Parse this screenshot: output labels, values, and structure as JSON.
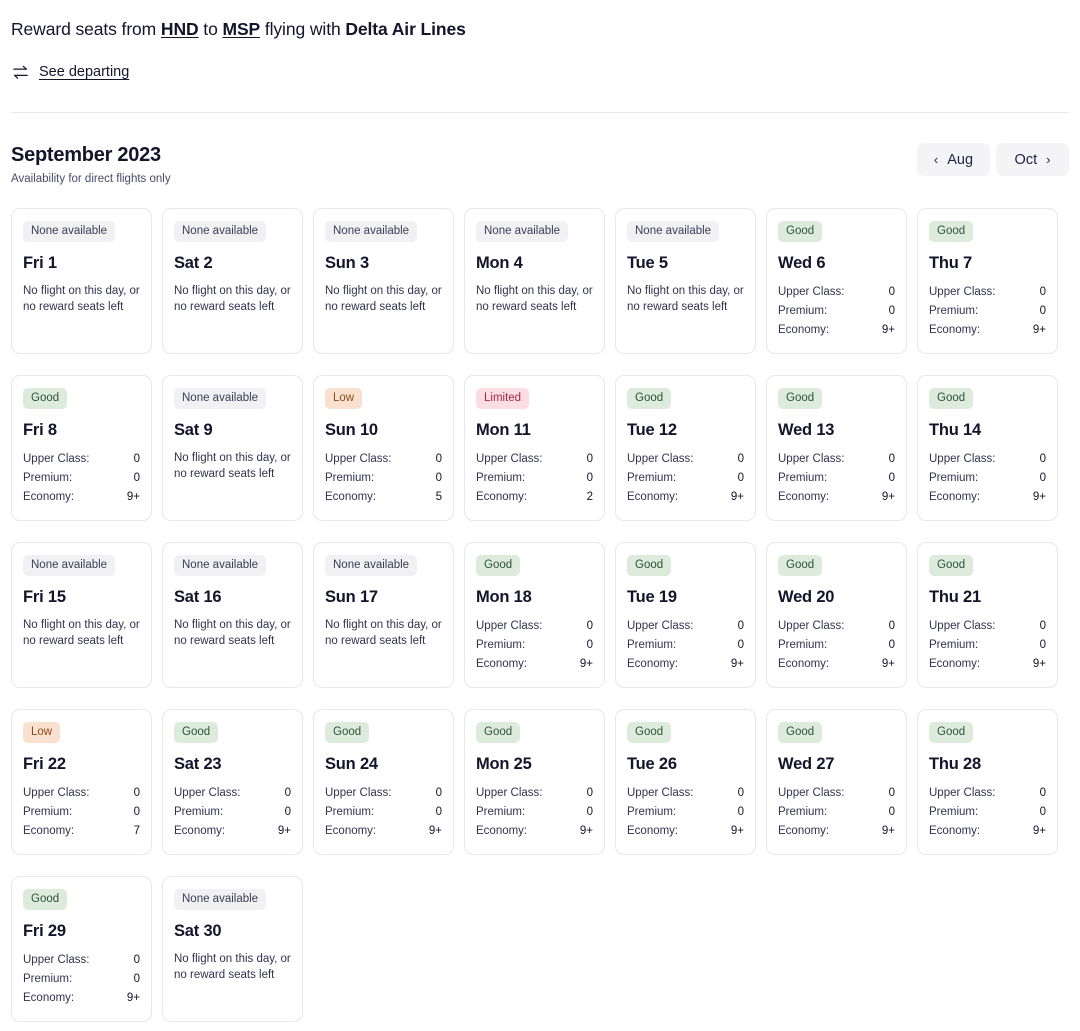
{
  "header": {
    "title_prefix": "Reward seats from ",
    "origin": "HND",
    "title_mid": " to ",
    "destination": "MSP",
    "title_mid2": " flying with ",
    "airline": "Delta Air Lines",
    "swap_icon": "swap-arrows-icon",
    "see_departing_label": "See departing"
  },
  "month": {
    "title": "September 2023",
    "subtitle": "Availability for direct flights only",
    "prev_label": "Aug",
    "prev_chevron": "‹",
    "next_label": "Oct",
    "next_chevron": "›"
  },
  "legend_colors": {
    "good_bg": "#dcebdc",
    "good_text": "#2e5436",
    "low_bg": "#fae0cf",
    "low_text": "#8a4b1c",
    "limited_bg": "#fbdde4",
    "limited_text": "#a6264c",
    "none_bg": "#f1f1f3",
    "none_text": "#3c3c55"
  },
  "seat_labels": {
    "upper": "Upper Class:",
    "premium": "Premium:",
    "economy": "Economy:"
  },
  "no_flight_text": "No flight on this day, or no reward seats left",
  "days": [
    {
      "day": "Fri 1",
      "status": "None available",
      "status_key": "none",
      "available": false
    },
    {
      "day": "Sat 2",
      "status": "None available",
      "status_key": "none",
      "available": false
    },
    {
      "day": "Sun 3",
      "status": "None available",
      "status_key": "none",
      "available": false
    },
    {
      "day": "Mon 4",
      "status": "None available",
      "status_key": "none",
      "available": false
    },
    {
      "day": "Tue 5",
      "status": "None available",
      "status_key": "none",
      "available": false
    },
    {
      "day": "Wed 6",
      "status": "Good",
      "status_key": "good",
      "available": true,
      "upper": "0",
      "premium": "0",
      "economy": "9+"
    },
    {
      "day": "Thu 7",
      "status": "Good",
      "status_key": "good",
      "available": true,
      "upper": "0",
      "premium": "0",
      "economy": "9+"
    },
    {
      "day": "Fri 8",
      "status": "Good",
      "status_key": "good",
      "available": true,
      "upper": "0",
      "premium": "0",
      "economy": "9+"
    },
    {
      "day": "Sat 9",
      "status": "None available",
      "status_key": "none",
      "available": false
    },
    {
      "day": "Sun 10",
      "status": "Low",
      "status_key": "low",
      "available": true,
      "upper": "0",
      "premium": "0",
      "economy": "5"
    },
    {
      "day": "Mon 11",
      "status": "Limited",
      "status_key": "limited",
      "available": true,
      "upper": "0",
      "premium": "0",
      "economy": "2"
    },
    {
      "day": "Tue 12",
      "status": "Good",
      "status_key": "good",
      "available": true,
      "upper": "0",
      "premium": "0",
      "economy": "9+"
    },
    {
      "day": "Wed 13",
      "status": "Good",
      "status_key": "good",
      "available": true,
      "upper": "0",
      "premium": "0",
      "economy": "9+"
    },
    {
      "day": "Thu 14",
      "status": "Good",
      "status_key": "good",
      "available": true,
      "upper": "0",
      "premium": "0",
      "economy": "9+"
    },
    {
      "day": "Fri 15",
      "status": "None available",
      "status_key": "none",
      "available": false
    },
    {
      "day": "Sat 16",
      "status": "None available",
      "status_key": "none",
      "available": false
    },
    {
      "day": "Sun 17",
      "status": "None available",
      "status_key": "none",
      "available": false
    },
    {
      "day": "Mon 18",
      "status": "Good",
      "status_key": "good",
      "available": true,
      "upper": "0",
      "premium": "0",
      "economy": "9+"
    },
    {
      "day": "Tue 19",
      "status": "Good",
      "status_key": "good",
      "available": true,
      "upper": "0",
      "premium": "0",
      "economy": "9+"
    },
    {
      "day": "Wed 20",
      "status": "Good",
      "status_key": "good",
      "available": true,
      "upper": "0",
      "premium": "0",
      "economy": "9+"
    },
    {
      "day": "Thu 21",
      "status": "Good",
      "status_key": "good",
      "available": true,
      "upper": "0",
      "premium": "0",
      "economy": "9+"
    },
    {
      "day": "Fri 22",
      "status": "Low",
      "status_key": "low",
      "available": true,
      "upper": "0",
      "premium": "0",
      "economy": "7"
    },
    {
      "day": "Sat 23",
      "status": "Good",
      "status_key": "good",
      "available": true,
      "upper": "0",
      "premium": "0",
      "economy": "9+"
    },
    {
      "day": "Sun 24",
      "status": "Good",
      "status_key": "good",
      "available": true,
      "upper": "0",
      "premium": "0",
      "economy": "9+"
    },
    {
      "day": "Mon 25",
      "status": "Good",
      "status_key": "good",
      "available": true,
      "upper": "0",
      "premium": "0",
      "economy": "9+"
    },
    {
      "day": "Tue 26",
      "status": "Good",
      "status_key": "good",
      "available": true,
      "upper": "0",
      "premium": "0",
      "economy": "9+"
    },
    {
      "day": "Wed 27",
      "status": "Good",
      "status_key": "good",
      "available": true,
      "upper": "0",
      "premium": "0",
      "economy": "9+"
    },
    {
      "day": "Thu 28",
      "status": "Good",
      "status_key": "good",
      "available": true,
      "upper": "0",
      "premium": "0",
      "economy": "9+"
    },
    {
      "day": "Fri 29",
      "status": "Good",
      "status_key": "good",
      "available": true,
      "upper": "0",
      "premium": "0",
      "economy": "9+"
    },
    {
      "day": "Sat 30",
      "status": "None available",
      "status_key": "none",
      "available": false
    }
  ]
}
